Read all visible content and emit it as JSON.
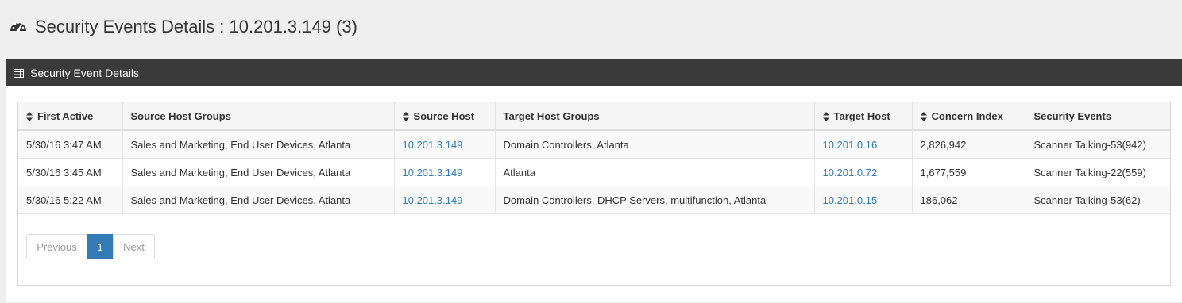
{
  "header": {
    "title": "Security Events Details : 10.201.3.149 (3)",
    "icon": "dashboard-gauge-icon"
  },
  "panel": {
    "title": "Security Event Details",
    "icon": "table-grid-icon"
  },
  "table": {
    "columns": [
      {
        "label": "First Active",
        "sortable": true
      },
      {
        "label": "Source Host Groups",
        "sortable": false
      },
      {
        "label": "Source Host",
        "sortable": true
      },
      {
        "label": "Target Host Groups",
        "sortable": false
      },
      {
        "label": "Target Host",
        "sortable": true
      },
      {
        "label": "Concern Index",
        "sortable": true
      },
      {
        "label": "Security Events",
        "sortable": false
      }
    ],
    "rows": [
      [
        "5/30/16 3:47 AM",
        "Sales and Marketing, End User Devices, Atlanta",
        "10.201.3.149",
        "Domain Controllers, Atlanta",
        "10.201.0.16",
        "2,826,942",
        "Scanner Talking-53(942)"
      ],
      [
        "5/30/16 3:45 AM",
        "Sales and Marketing, End User Devices, Atlanta",
        "10.201.3.149",
        "Atlanta",
        "10.201.0.72",
        "1,677,559",
        "Scanner Talking-22(559)"
      ],
      [
        "5/30/16 5:22 AM",
        "Sales and Marketing, End User Devices, Atlanta",
        "10.201.3.149",
        "Domain Controllers, DHCP Servers, multifunction, Atlanta",
        "10.201.0.15",
        "186,062",
        "Scanner Talking-53(62)"
      ]
    ]
  },
  "pagination": {
    "previous": "Previous",
    "current": "1",
    "next": "Next"
  },
  "colors": {
    "link": "#337ab7",
    "panel_header": "#3a3a3a",
    "active_page": "#337ab7"
  }
}
